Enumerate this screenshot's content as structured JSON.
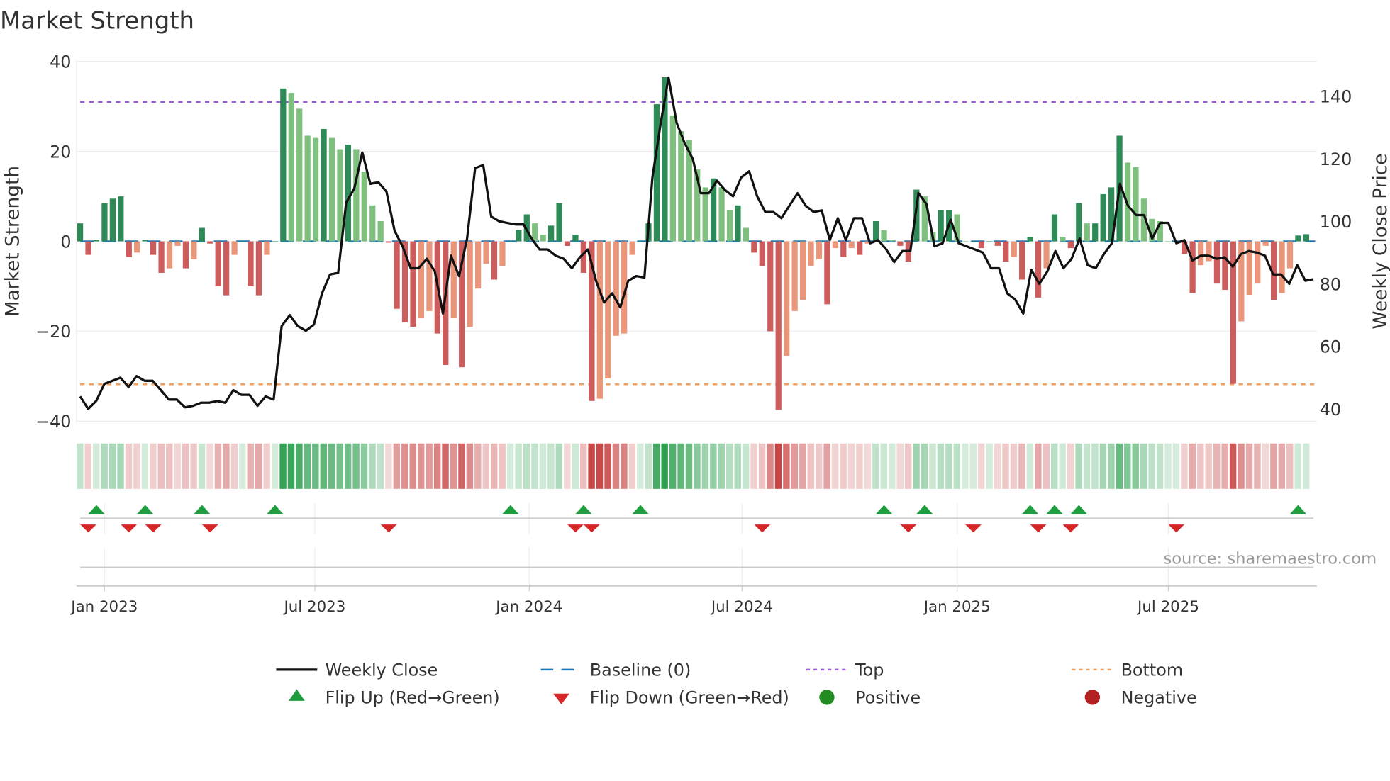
{
  "chart_data": {
    "type": "bar",
    "title": "Market Strength",
    "ylabel": "Market Strength",
    "y2label": "Weekly Close Price",
    "ylim": [
      -40.4,
      40.2
    ],
    "y2lim": [
      35.5,
      151.4
    ],
    "yticks": [
      "40",
      "20",
      "0",
      "−20",
      "−40"
    ],
    "ytick_values": [
      40,
      20,
      0,
      -20,
      -40
    ],
    "y2ticks": [
      "140",
      "120",
      "100",
      "80",
      "60",
      "40"
    ],
    "y2tick_values": [
      140,
      120,
      100,
      80,
      60,
      40
    ],
    "xticks": [
      {
        "label": "Jan 2023",
        "week": 3
      },
      {
        "label": "Jul 2023",
        "week": 29
      },
      {
        "label": "Jan 2024",
        "week": 55.5
      },
      {
        "label": "Jul 2024",
        "week": 81.8
      },
      {
        "label": "Jan 2025",
        "week": 108.4
      },
      {
        "label": "Jul 2025",
        "week": 134.5
      }
    ],
    "top_level": 31,
    "bottom_level": -31.8,
    "baseline": 0,
    "strength": [
      4,
      -3,
      0.3,
      8.5,
      9.5,
      10,
      -3.5,
      -2.5,
      0.3,
      -3,
      -7,
      -6,
      -1,
      -6,
      -4,
      3,
      -0.5,
      -10,
      -12,
      -3,
      0,
      -10,
      -12,
      -3,
      0,
      34,
      33,
      29.5,
      23.5,
      23,
      25,
      23,
      20.5,
      21.5,
      20.5,
      15.5,
      8,
      4.5,
      -0.3,
      -15,
      -18,
      -19,
      -17,
      -15.5,
      -20.5,
      -27.5,
      -17,
      -28,
      -19,
      -10.5,
      -5,
      -8.5,
      -5.5,
      0,
      2.5,
      6,
      4,
      1.5,
      3.5,
      8.5,
      -1,
      1.5,
      -7,
      -35.5,
      -35,
      -30.5,
      -21,
      -20.5,
      -3,
      0,
      4,
      30.5,
      36.5,
      28,
      24.5,
      22.5,
      16,
      12,
      14,
      12,
      7,
      8,
      3,
      -2.5,
      -5.5,
      -20,
      -37.5,
      -25.5,
      -15.5,
      -13,
      -5.5,
      -4,
      -14,
      -1.5,
      -3.5,
      -1.5,
      -3,
      -0.5,
      4.5,
      2.5,
      0.3,
      -1,
      -4.5,
      11.5,
      10,
      2,
      7,
      7,
      6,
      0,
      0,
      -1.5,
      0,
      -1,
      -4.5,
      -3.5,
      -8.5,
      1,
      -12.5,
      -6,
      6,
      1,
      -1.5,
      8.5,
      4,
      4,
      10.5,
      12,
      23.5,
      17.5,
      16.5,
      9.5,
      5,
      4.5,
      0,
      0,
      -2.8,
      -11.5,
      -5.3,
      -4.4,
      -9.4,
      -10.8,
      -31.7,
      -17.8,
      -11.9,
      -9.4,
      -1,
      -13,
      -11.5,
      -6,
      1.3,
      1.6
    ],
    "weekly_close": [
      44,
      40,
      42.6,
      48,
      49,
      50,
      47,
      50.5,
      49,
      49,
      46,
      43,
      43,
      40.5,
      41,
      42,
      42,
      42.5,
      42,
      46,
      44.5,
      44.5,
      41,
      44,
      43,
      66.5,
      70,
      66.5,
      65,
      67,
      77,
      83,
      83.5,
      106,
      110.5,
      122,
      112,
      112.5,
      109.5,
      97,
      92,
      85,
      85,
      88,
      84,
      70.5,
      89,
      82.5,
      94.5,
      117,
      118,
      101.5,
      100,
      99.5,
      99,
      99,
      94.5,
      91,
      91,
      89,
      88,
      85,
      88.5,
      91,
      81,
      74,
      77,
      72.5,
      81,
      82.5,
      82,
      114,
      131,
      146,
      131.5,
      125,
      120,
      109,
      109,
      113,
      110,
      108,
      114,
      116,
      108,
      103,
      103,
      101,
      105,
      109,
      105,
      103,
      103.5,
      94,
      101,
      94,
      101,
      101,
      93,
      94,
      91,
      87,
      90.5,
      90.5,
      109,
      105.5,
      92,
      93,
      100.5,
      93,
      92,
      91,
      90,
      85,
      85,
      77,
      75,
      70.5,
      84.5,
      80,
      84,
      90.5,
      85,
      88,
      94.5,
      86,
      85,
      89.5,
      93,
      112,
      105,
      102,
      102,
      94.5,
      99.5,
      99.5,
      93,
      94,
      87.5,
      89,
      89,
      88,
      88.5,
      85.5,
      89.5,
      90.5,
      90,
      89,
      83,
      83,
      80,
      86,
      81,
      81.5
    ],
    "flip_up_weeks": [
      2,
      8,
      15,
      24,
      53,
      62,
      69,
      99,
      104,
      117,
      120,
      123,
      150
    ],
    "flip_down_weeks": [
      1,
      6,
      9,
      16,
      38,
      61,
      63,
      84,
      102,
      110,
      118,
      122,
      135
    ],
    "legend": [
      {
        "label": "Weekly Close",
        "kind": "line",
        "color": "#111111"
      },
      {
        "label": "Baseline (0)",
        "kind": "dash",
        "color": "#1f77b4"
      },
      {
        "label": "Top",
        "kind": "dot",
        "color": "#9b59d6"
      },
      {
        "label": "Bottom",
        "kind": "dot",
        "color": "#f0a060"
      },
      {
        "label": "Flip Up (Red→Green)",
        "kind": "tri-up",
        "color": "#1e9e3e"
      },
      {
        "label": "Flip Down (Green→Red)",
        "kind": "tri-down",
        "color": "#d62728"
      },
      {
        "label": "Positive",
        "kind": "circle",
        "color": "#228b22"
      },
      {
        "label": "Negative",
        "kind": "circle",
        "color": "#b22222"
      }
    ],
    "legend_placement": "bottom",
    "colors": {
      "pos_strong": "#2e8b57",
      "pos_weak": "#7fc07f",
      "neg_strong": "#cd5c5c",
      "neg_weak": "#e9967a"
    },
    "source": "source: sharemaestro.com"
  }
}
